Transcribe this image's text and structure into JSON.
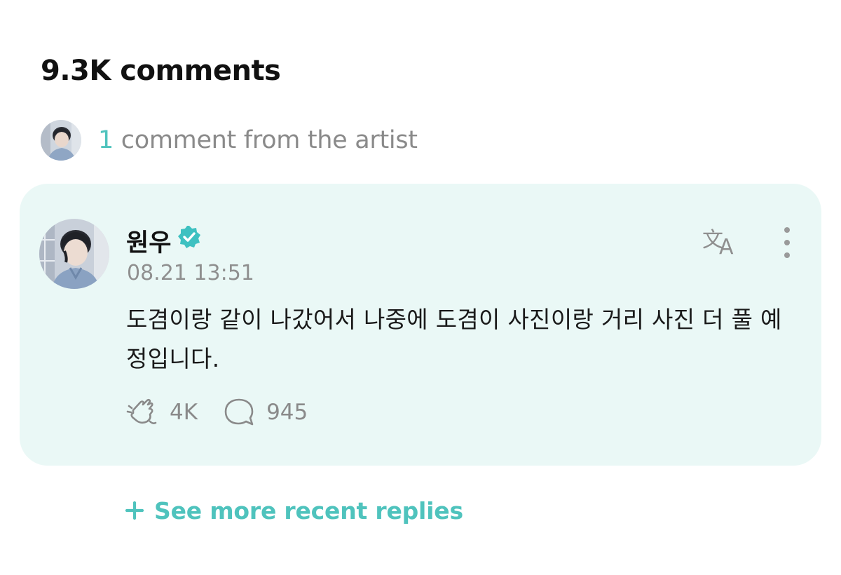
{
  "comments_header": {
    "title": "9.3K comments"
  },
  "artist_comments": {
    "count": "1",
    "label": " comment from the artist",
    "avatar_icon": "artist-avatar"
  },
  "comment": {
    "author": "원우",
    "verified_icon": "verified-badge-icon",
    "timestamp": "08.21 13:51",
    "body": "도겸이랑 같이 나갔어서 나중에 도겸이 사진이랑 거리 사진 더 풀 예정입니다.",
    "likes": "4K",
    "replies": "945",
    "like_icon": "cheer-hand-icon",
    "reply_icon": "speech-bubble-icon",
    "translate_icon": "translate-icon",
    "more_icon": "more-vertical-icon"
  },
  "see_more": {
    "label": "See more recent replies",
    "icon": "plus-icon"
  },
  "colors": {
    "accent": "#4fc3bd",
    "card_background": "#eaf8f6",
    "muted_text": "#8a8a8a",
    "verified": "#3ec1c1"
  }
}
